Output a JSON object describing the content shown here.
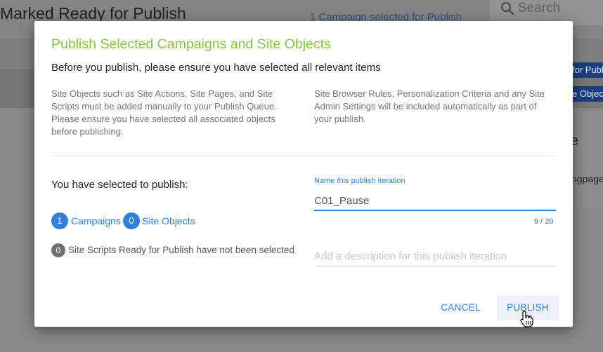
{
  "background": {
    "page_title": "Marked Ready for Publish",
    "campaign_selected": "1 Campaign selected for Publish",
    "search_placeholder": "Search",
    "button_1": "for Publ",
    "button_2": "e Objects",
    "panel_letter": "e",
    "panel_text": "ngpage"
  },
  "dialog": {
    "title": "Publish Selected Campaigns and Site Objects",
    "subtitle": "Before you publish, please ensure you have selected all relevant items",
    "note_left": "Site Objects such as Site Actions, Site Pages, and Site Scripts must be added manually to your Publish Queue. Please ensure you have selected all associated objects before publishing.",
    "note_right": "Site Browser Rules, Personalization Criteria and any Site Admin Settings will be included automatically as part of your publish.",
    "selected_label": "You have selected to publish:",
    "campaigns_count": "1",
    "campaigns_label": "Campaigns",
    "site_objects_count": "0",
    "site_objects_label": "Site Objects",
    "scripts_count": "0",
    "scripts_label": "Site Scripts Ready for Publish have not been selected",
    "name_field_label": "Name this publish iteration",
    "name_field_value": "C01_Pause",
    "name_counter": "9 / 20",
    "description_placeholder": "Add a description for this publish iteration",
    "cancel_label": "CANCEL",
    "publish_label": "PUBLISH"
  },
  "colors": {
    "title_green": "#8bc34a",
    "link_blue": "#2f80d6",
    "overlay": "#7d7d7d"
  },
  "icons": [
    "search-icon",
    "hand-pointer-icon"
  ]
}
